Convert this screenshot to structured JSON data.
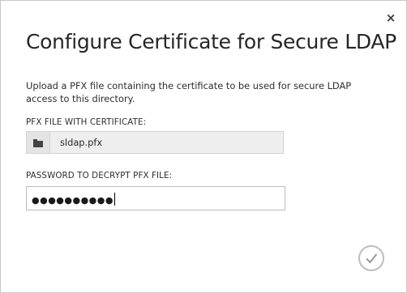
{
  "dialog": {
    "title": "Configure Certificate for Secure LDAP",
    "description": "Upload a PFX file containing the certificate to be used for secure LDAP access to this directory.",
    "close_icon": "close-icon",
    "close_glyph": "×"
  },
  "pfx": {
    "label": "PFX FILE WITH CERTIFICATE:",
    "file_name": "sldap.pfx",
    "browse_icon": "folder-icon"
  },
  "password": {
    "label": "PASSWORD TO DECRYPT PFX FILE:",
    "masked_value": "●●●●●●●●●●"
  },
  "ok_button": {
    "icon": "checkmark-icon"
  },
  "colors": {
    "border": "#c8c8c8",
    "file_field_bg": "#eeeeee",
    "ok_circle": "#bdbdbd"
  }
}
